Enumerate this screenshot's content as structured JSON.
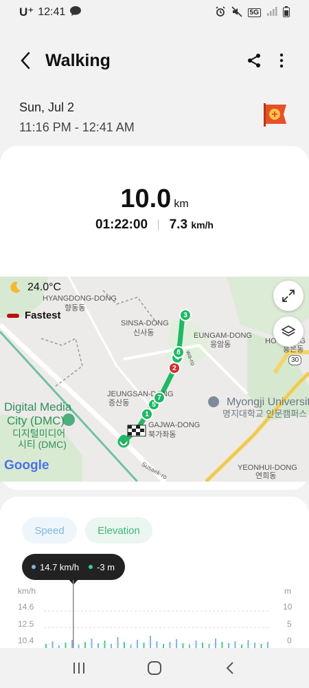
{
  "status": {
    "carrier": "U⁺",
    "time": "12:41",
    "network": "5G"
  },
  "header": {
    "title": "Walking"
  },
  "session": {
    "date": "Sun, Jul 2",
    "time_range": "11:16 PM - 12:41 AM"
  },
  "summary": {
    "distance": "10.0",
    "distance_unit": "km",
    "duration": "01:22:00",
    "speed": "7.3",
    "speed_unit": "km/h"
  },
  "map": {
    "temperature": "24.0°C",
    "legend_fastest": "Fastest",
    "labels": {
      "hyangdong": "HYANGDONG-DONG",
      "hyangdong_ko": "향동동",
      "sinsa": "SINSA-DONG",
      "sinsa_ko": "신사동",
      "eungam": "EUNGAM-DONG",
      "eungam_ko": "응암동",
      "hong": "HO",
      "hong2": "DONG",
      "hong_ko": "홍은동",
      "jeungsan": "JEUNGSAN-DONG",
      "jeungsan_ko": "증산동",
      "bukgajwa": "GAJWA-DONG",
      "bukgajwa_ko": "북가좌동",
      "dmc1": "Digital Media",
      "dmc2": "City (DMC)",
      "dmc_ko1": "디지털미디어",
      "dmc_ko2": "시티 (DMC)",
      "myongji1": "Myongji Universit",
      "myongji_ko": "명지대학교 인문캠퍼스",
      "yeonhui": "YEONHUI-DONG",
      "yeonhui_ko": "연희동",
      "susaek": "Susaek-ro",
      "road": "wa-ro",
      "route_30": "30",
      "google": "Google"
    },
    "markers": [
      "1",
      "5",
      "7",
      "2",
      "4",
      "8",
      "3"
    ]
  },
  "chart": {
    "tabs": {
      "speed": "Speed",
      "elevation": "Elevation"
    },
    "tooltip": {
      "speed": "14.7 km/h",
      "elevation": "-3 m"
    },
    "left_unit": "km/h",
    "right_unit": "m",
    "left_ticks": [
      "14.6",
      "12.5",
      "10.4"
    ],
    "right_ticks": [
      "10",
      "5",
      "0"
    ],
    "colors": {
      "speed": "#7fb6e2",
      "elevation": "#3fcf8e"
    }
  },
  "colors": {
    "route": "#1fb864",
    "fastest": "#d32f2f",
    "accent_speed": "#7fb6e2",
    "accent_elevation": "#3fb57a"
  }
}
